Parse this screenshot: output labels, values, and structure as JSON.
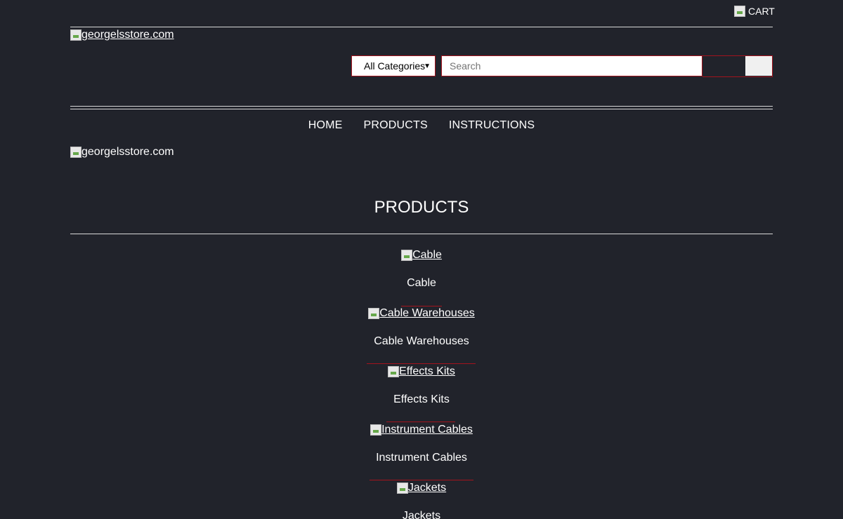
{
  "header": {
    "cart_label": "CART",
    "logo_alt": "georgelsstore.com"
  },
  "search": {
    "category_selected": "All Categories",
    "placeholder": "Search"
  },
  "nav": {
    "items": [
      {
        "label": "HOME"
      },
      {
        "label": "PRODUCTS"
      },
      {
        "label": "INSTRUCTIONS"
      }
    ]
  },
  "banner": {
    "alt": "georgelsstore.com"
  },
  "main": {
    "title": "PRODUCTS",
    "products": [
      {
        "img_alt": "Cable",
        "name": "Cable"
      },
      {
        "img_alt": "Cable Warehouses",
        "name": "Cable Warehouses"
      },
      {
        "img_alt": "Effects Kits",
        "name": "Effects Kits"
      },
      {
        "img_alt": "Instrument Cables",
        "name": "Instrument Cables"
      },
      {
        "img_alt": "Jackets",
        "name": "Jackets"
      }
    ]
  },
  "colors": {
    "background": "#21232b",
    "accent": "#a3131d",
    "text": "#ffffff"
  }
}
